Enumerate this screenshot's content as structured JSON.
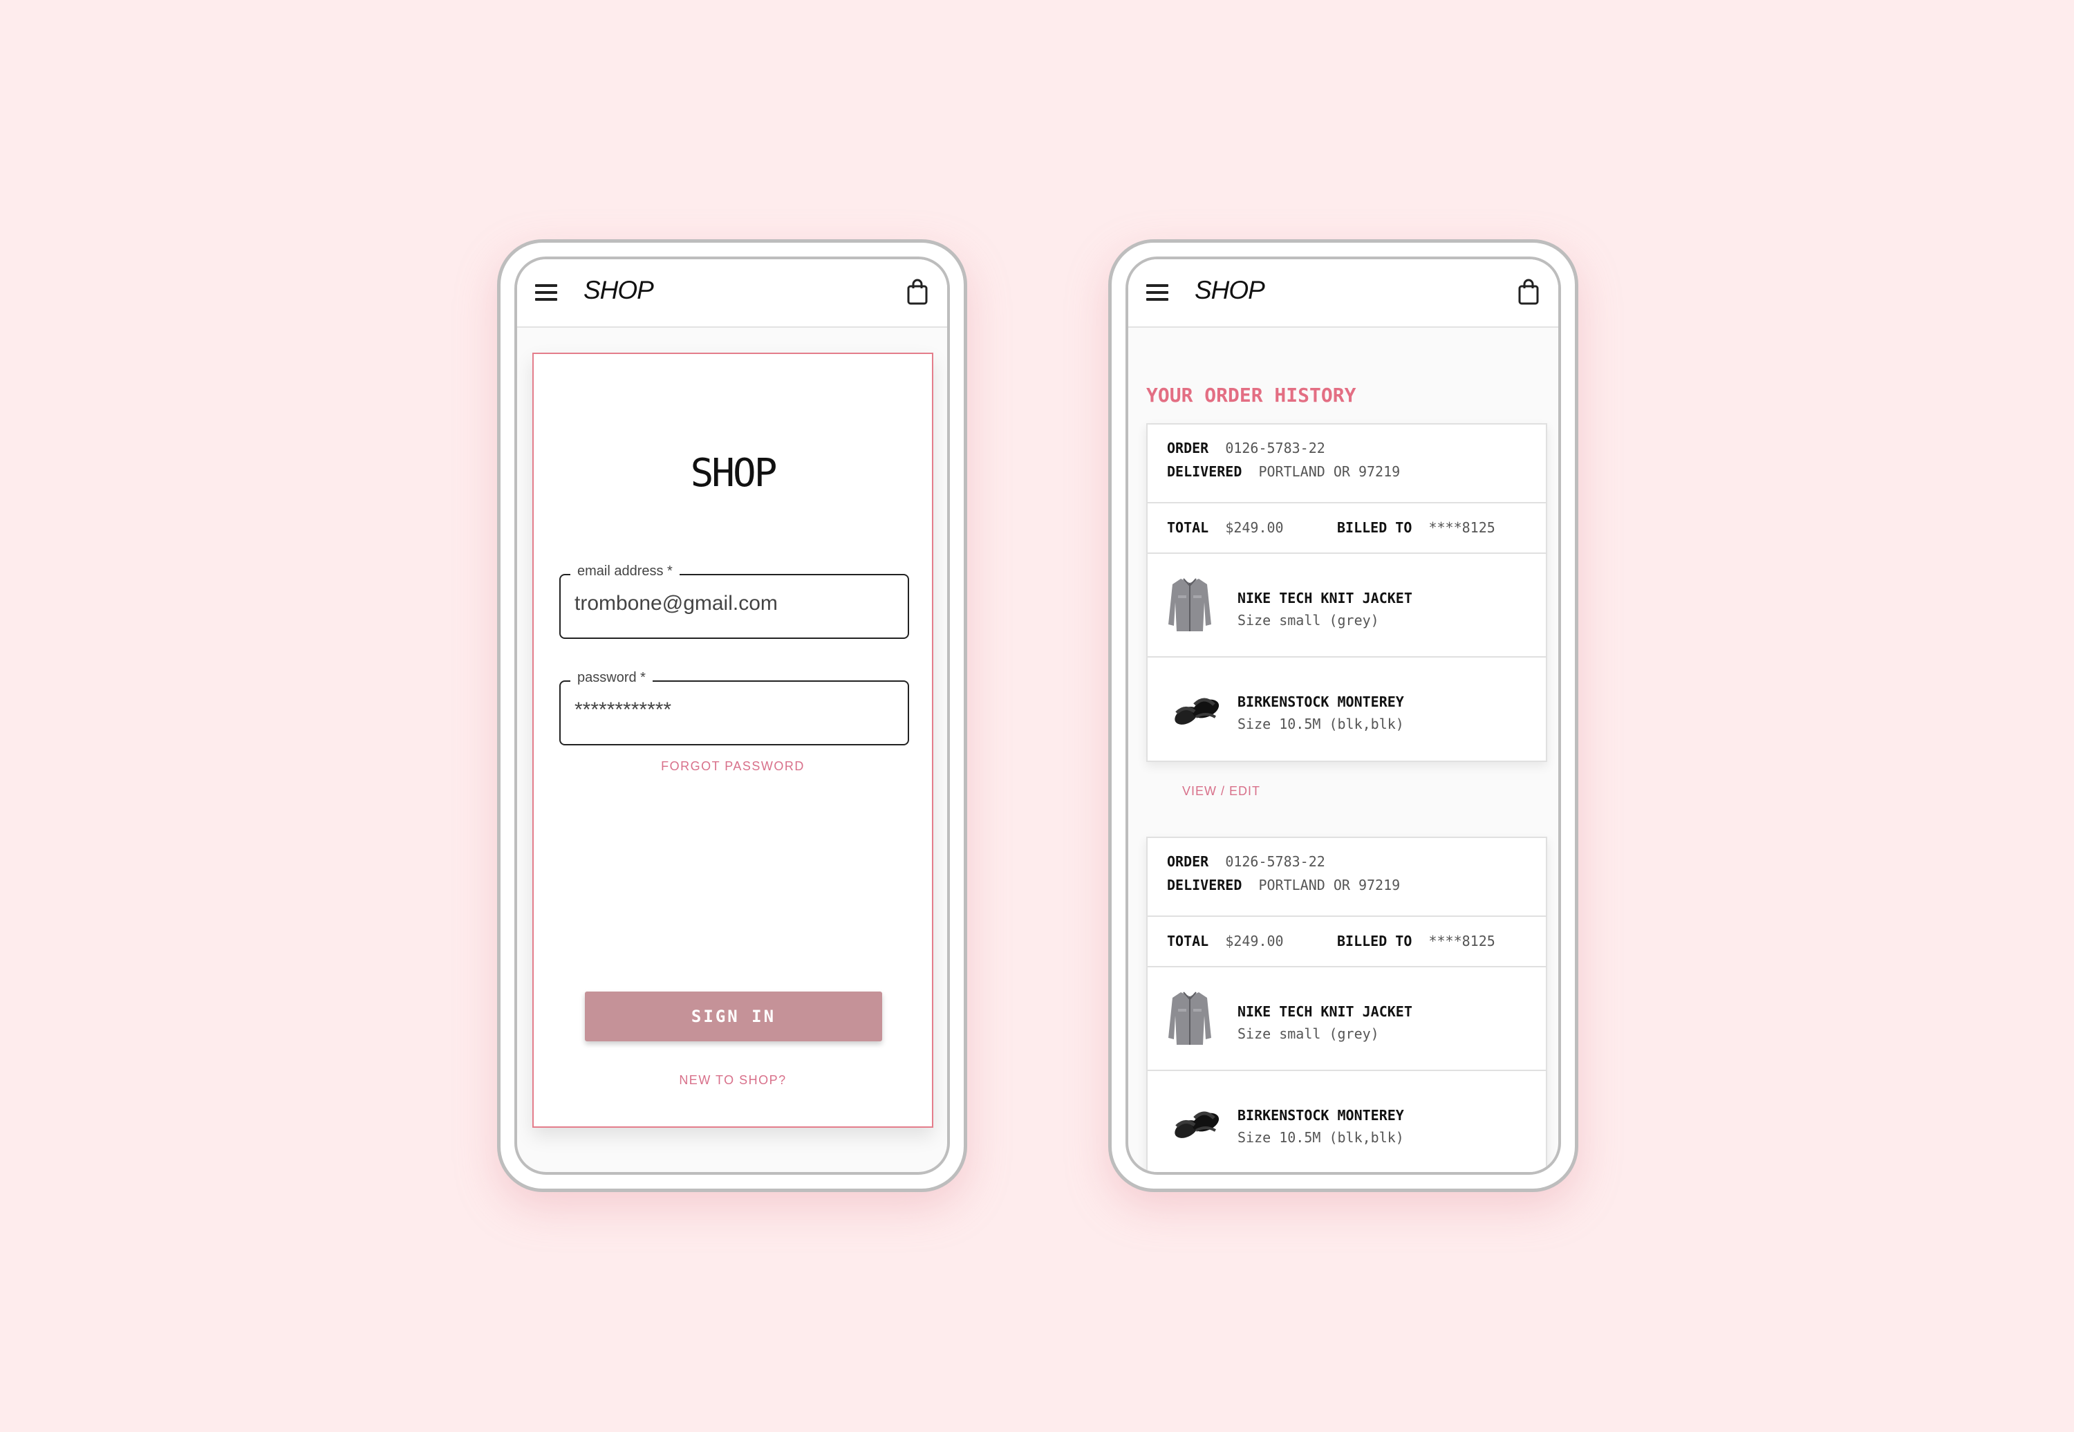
{
  "colors": {
    "background": "#feeced",
    "accent": "#e36e83",
    "link": "#d8708a",
    "button": "#c59298",
    "card_border": "#e47d8b"
  },
  "appbar": {
    "brand": "SHOP",
    "menu_icon": "hamburger-menu-icon",
    "cart_icon": "shopping-bag-icon"
  },
  "login": {
    "title": "SHOP",
    "email": {
      "label": "email address *",
      "value": "trombone@gmail.com"
    },
    "password": {
      "label": "password *",
      "value": "************"
    },
    "forgot_password": "FORGOT PASSWORD",
    "sign_in": "SIGN IN",
    "new_to_shop": "NEW TO SHOP?"
  },
  "history": {
    "title": "YOUR ORDER HISTORY",
    "view_edit": "VIEW / EDIT",
    "orders": [
      {
        "order_label": "ORDER",
        "order_number": "0126-5783-22",
        "delivered_label": "DELIVERED",
        "delivered_to": "PORTLAND OR 97219",
        "total_label": "TOTAL",
        "total": "$249.00",
        "billed_label": "BILLED TO",
        "billed_to": "****8125",
        "items": [
          {
            "name": "NIKE TECH KNIT JACKET",
            "detail": "Size small (grey)",
            "icon": "jacket-icon"
          },
          {
            "name": "BIRKENSTOCK MONTEREY",
            "detail": "Size 10.5M (blk,blk)",
            "icon": "sandals-icon"
          }
        ]
      },
      {
        "order_label": "ORDER",
        "order_number": "0126-5783-22",
        "delivered_label": "DELIVERED",
        "delivered_to": "PORTLAND OR 97219",
        "total_label": "TOTAL",
        "total": "$249.00",
        "billed_label": "BILLED TO",
        "billed_to": "****8125",
        "items": [
          {
            "name": "NIKE TECH KNIT JACKET",
            "detail": "Size small (grey)",
            "icon": "jacket-icon"
          },
          {
            "name": "BIRKENSTOCK MONTEREY",
            "detail": "Size 10.5M (blk,blk)",
            "icon": "sandals-icon"
          }
        ]
      }
    ]
  }
}
